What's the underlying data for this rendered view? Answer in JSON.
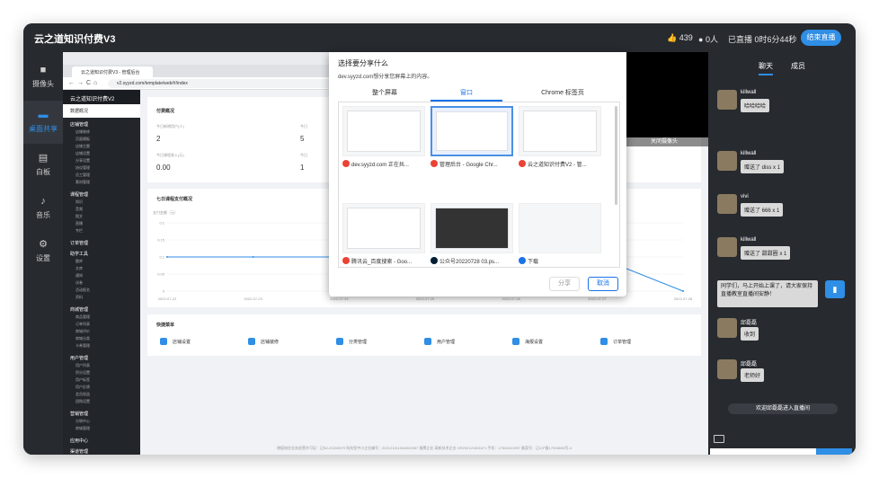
{
  "app": {
    "title": "云之道知识付费V3"
  },
  "topbar": {
    "likes": "439",
    "viewers": "0人",
    "live_time": "已直播 0时6分44秒",
    "end_button": "结束直播"
  },
  "leftnav": [
    {
      "label": "摄像头",
      "icon": "camera-icon"
    },
    {
      "label": "桌面共享",
      "icon": "monitor-icon"
    },
    {
      "label": "白板",
      "icon": "whiteboard-icon"
    },
    {
      "label": "音乐",
      "icon": "bell-icon"
    },
    {
      "label": "设置",
      "icon": "gear-icon"
    }
  ],
  "browser": {
    "tab_title": "云之道知识付费V3 - 管理后台",
    "url": "v2.syyzd.com/template/web/#/index"
  },
  "inner": {
    "header": "云之道知识付费V2",
    "overview_title": "数据概况",
    "menu": [
      {
        "section": "店铺管理",
        "items": [
          "店铺装修",
          "页面模板",
          "店铺主题",
          "店铺设置",
          "分享设置",
          "协议管理",
          "员工管理",
          "素材管理"
        ]
      },
      {
        "section": "课程管理",
        "items": [
          "知识",
          "音频",
          "图文",
          "直播",
          "专栏"
        ]
      },
      {
        "section": "订单管理",
        "items": []
      },
      {
        "section": "助学工具",
        "items": [
          "题库",
          "文库",
          "通知",
          "试卷",
          "活动报名",
          "资料"
        ]
      },
      {
        "section": "商城管理",
        "items": [
          "商品管理",
          "订单列表",
          "商城评价",
          "商城分类",
          "卡券管理"
        ]
      },
      {
        "section": "用户管理",
        "items": [
          "用户列表",
          "积分设置",
          "用户标签",
          "用户反馈",
          "会员权益",
          "团购设置"
        ]
      },
      {
        "section": "营销管理",
        "items": [
          "分销中心",
          "商城管理"
        ]
      },
      {
        "section": "应用中心",
        "items": []
      },
      {
        "section": "渠道管理",
        "items": []
      }
    ],
    "stats": {
      "title": "付费概况",
      "labels": [
        "今日新增用户(人)",
        "今日课程收入(元)"
      ],
      "values": [
        "2",
        "0.00"
      ],
      "col2_values": [
        "5",
        "1"
      ],
      "col2_label": "今日"
    },
    "chart": {
      "title": "七日课程支付概况",
      "ylabel": "支付金额（元）"
    },
    "quick": {
      "title": "快捷菜单",
      "items": [
        "店铺设置",
        "店铺装修",
        "分类管理",
        "用户管理",
        "海报设置",
        "订单管理"
      ]
    },
    "footer": "增值电信业务经营许可证：辽B2-20200579 科技型中小企业编号：2021210113A0002067 雏鹰企业 高新技术企业 GR202121001671 手机：17602421997 备案号：辽ICP备17006698号-4"
  },
  "chart_data": {
    "type": "line",
    "categories": [
      "2022-07-22",
      "2022-07-23",
      "2022-07-24",
      "2022-07-25",
      "2022-07-26",
      "2022-07-27",
      "2022-07-28"
    ],
    "values": [
      0.1,
      0.1,
      0.1,
      0,
      0.1,
      0.1,
      0
    ],
    "ylim": [
      0,
      0.2
    ],
    "yticks": [
      "0.2",
      "0.15",
      "0.1",
      "0.05",
      "0"
    ],
    "ylabel": "支付金额（元）"
  },
  "camera": {
    "close_label": "关闭摄像头"
  },
  "share_dialog": {
    "title": "选择要分享什么",
    "description": "dev.syyzd.com想分享您屏幕上的内容。",
    "tabs": [
      "整个屏幕",
      "窗口",
      "Chrome 标签页"
    ],
    "windows": [
      {
        "label": "dev.syyzd.com 正在共...",
        "icon_color": "#ea4335"
      },
      {
        "label": "管理后台 - Google Chr...",
        "icon_color": "#ea4335"
      },
      {
        "label": "云之道知识付费V2 - 管...",
        "icon_color": "#ea4335"
      },
      {
        "label": "腾讯云_百度搜索 - Goo...",
        "icon_color": "#ea4335"
      },
      {
        "label": "公众号20220728 03.ps...",
        "icon_color": "#001e36"
      },
      {
        "label": "下载",
        "icon_color": "#1a73e8"
      }
    ],
    "share_button": "分享",
    "cancel_button": "取消"
  },
  "chat": {
    "tabs": [
      "聊天",
      "成员"
    ],
    "messages": [
      {
        "name": "killwall",
        "text": "哈哈哈哈"
      },
      {
        "name": "killwall",
        "text": "赠送了 diss  x 1"
      },
      {
        "name": "vivi",
        "text": "赠送了 666  x 1"
      },
      {
        "name": "killwall",
        "text": "赠送了 甜甜圈  x 1"
      }
    ],
    "notice": "同学们，马上开始上课了，请大家保持直播教室直播间安静！",
    "messages2": [
      {
        "name": "邱磊磊",
        "text": "收到"
      },
      {
        "name": "邱磊磊",
        "text": "老师好"
      }
    ],
    "welcome": "欢迎邱磊磊进入直播间",
    "input_placeholder": "请输入内容",
    "send_label": "发送"
  }
}
